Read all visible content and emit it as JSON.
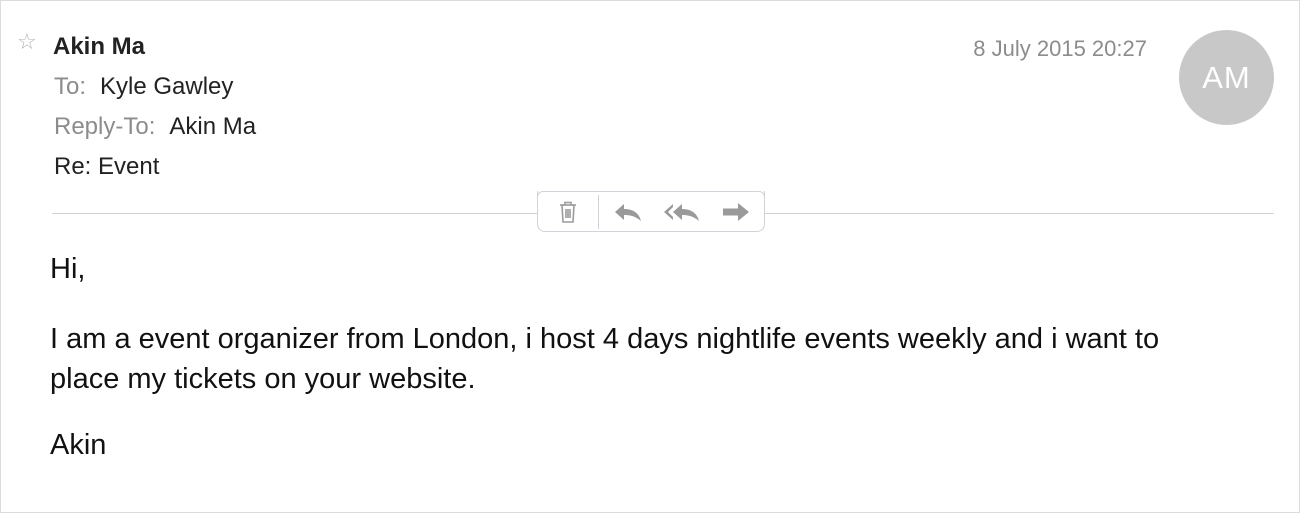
{
  "message": {
    "sender": "Akin Ma",
    "date": "8 July 2015 20:27",
    "to_label": "To:",
    "to_value": "Kyle Gawley",
    "reply_to_label": "Reply-To:",
    "reply_to_value": "Akin Ma",
    "subject": "Re: Event",
    "avatar_initials": "AM",
    "body": {
      "greeting": "Hi,",
      "paragraph": "I am a event organizer from London, i host 4 days nightlife events weekly and i want to place my tickets on your website.",
      "signature": "Akin"
    }
  },
  "toolbar": {
    "buttons": [
      "trash-icon",
      "reply-icon",
      "reply-all-icon",
      "forward-icon"
    ]
  },
  "colors": {
    "label_gray": "#8c8c8c",
    "avatar_bg": "#c8c8c8",
    "icon_gray": "#9a9a9a",
    "divider": "#d2d2d8"
  },
  "icons": {
    "star": "star-outline-icon"
  }
}
